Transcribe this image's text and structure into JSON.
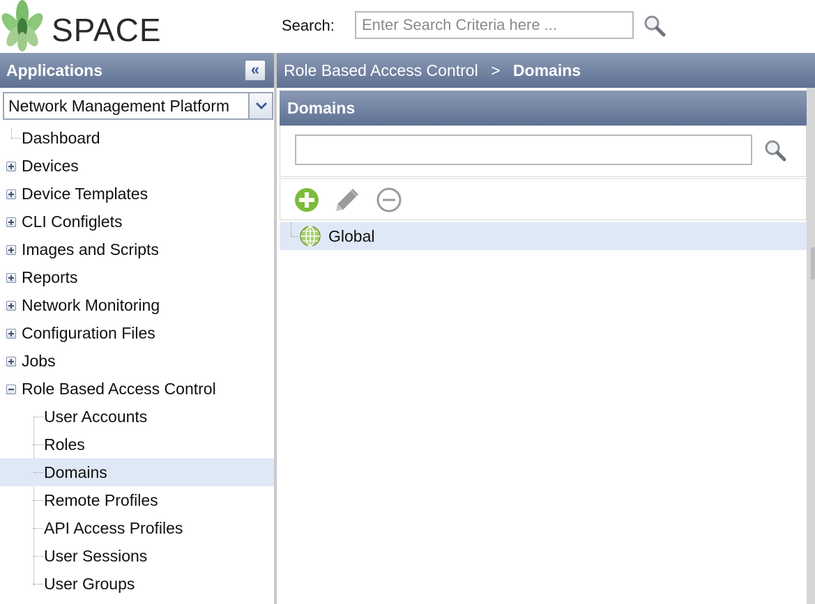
{
  "header": {
    "logo_text": "SPACE",
    "search_label": "Search:",
    "search_placeholder": "Enter Search Criteria here ..."
  },
  "sidebar": {
    "title": "Applications",
    "collapse_glyph": "«",
    "app_selector": "Network Management Platform",
    "items": [
      {
        "label": "Dashboard",
        "level": 0,
        "expander": "none"
      },
      {
        "label": "Devices",
        "level": 0,
        "expander": "plus"
      },
      {
        "label": "Device Templates",
        "level": 0,
        "expander": "plus"
      },
      {
        "label": "CLI Configlets",
        "level": 0,
        "expander": "plus"
      },
      {
        "label": "Images and Scripts",
        "level": 0,
        "expander": "plus"
      },
      {
        "label": "Reports",
        "level": 0,
        "expander": "plus"
      },
      {
        "label": "Network Monitoring",
        "level": 0,
        "expander": "plus"
      },
      {
        "label": "Configuration Files",
        "level": 0,
        "expander": "plus"
      },
      {
        "label": "Jobs",
        "level": 0,
        "expander": "plus"
      },
      {
        "label": "Role Based Access Control",
        "level": 0,
        "expander": "minus"
      },
      {
        "label": "User Accounts",
        "level": 1,
        "expander": "none"
      },
      {
        "label": "Roles",
        "level": 1,
        "expander": "none"
      },
      {
        "label": "Domains",
        "level": 1,
        "expander": "none",
        "selected": true
      },
      {
        "label": "Remote Profiles",
        "level": 1,
        "expander": "none"
      },
      {
        "label": "API Access Profiles",
        "level": 1,
        "expander": "none"
      },
      {
        "label": "User Sessions",
        "level": 1,
        "expander": "none"
      },
      {
        "label": "User Groups",
        "level": 1,
        "expander": "none"
      }
    ]
  },
  "breadcrumb": {
    "parent": "Role Based Access Control",
    "separator": ">",
    "current": "Domains"
  },
  "main": {
    "panel_title": "Domains",
    "filter_value": "",
    "toolbar": {
      "add_icon": "add-icon",
      "edit_icon": "pencil-icon",
      "delete_icon": "minus-circle-icon"
    },
    "rows": [
      {
        "label": "Global",
        "icon": "globe-icon"
      }
    ]
  },
  "colors": {
    "header_gradient_top": "#8a9ab4",
    "header_gradient_bottom": "#5f7093",
    "selection": "#dfe8f6",
    "add_green": "#7cbb3a"
  }
}
